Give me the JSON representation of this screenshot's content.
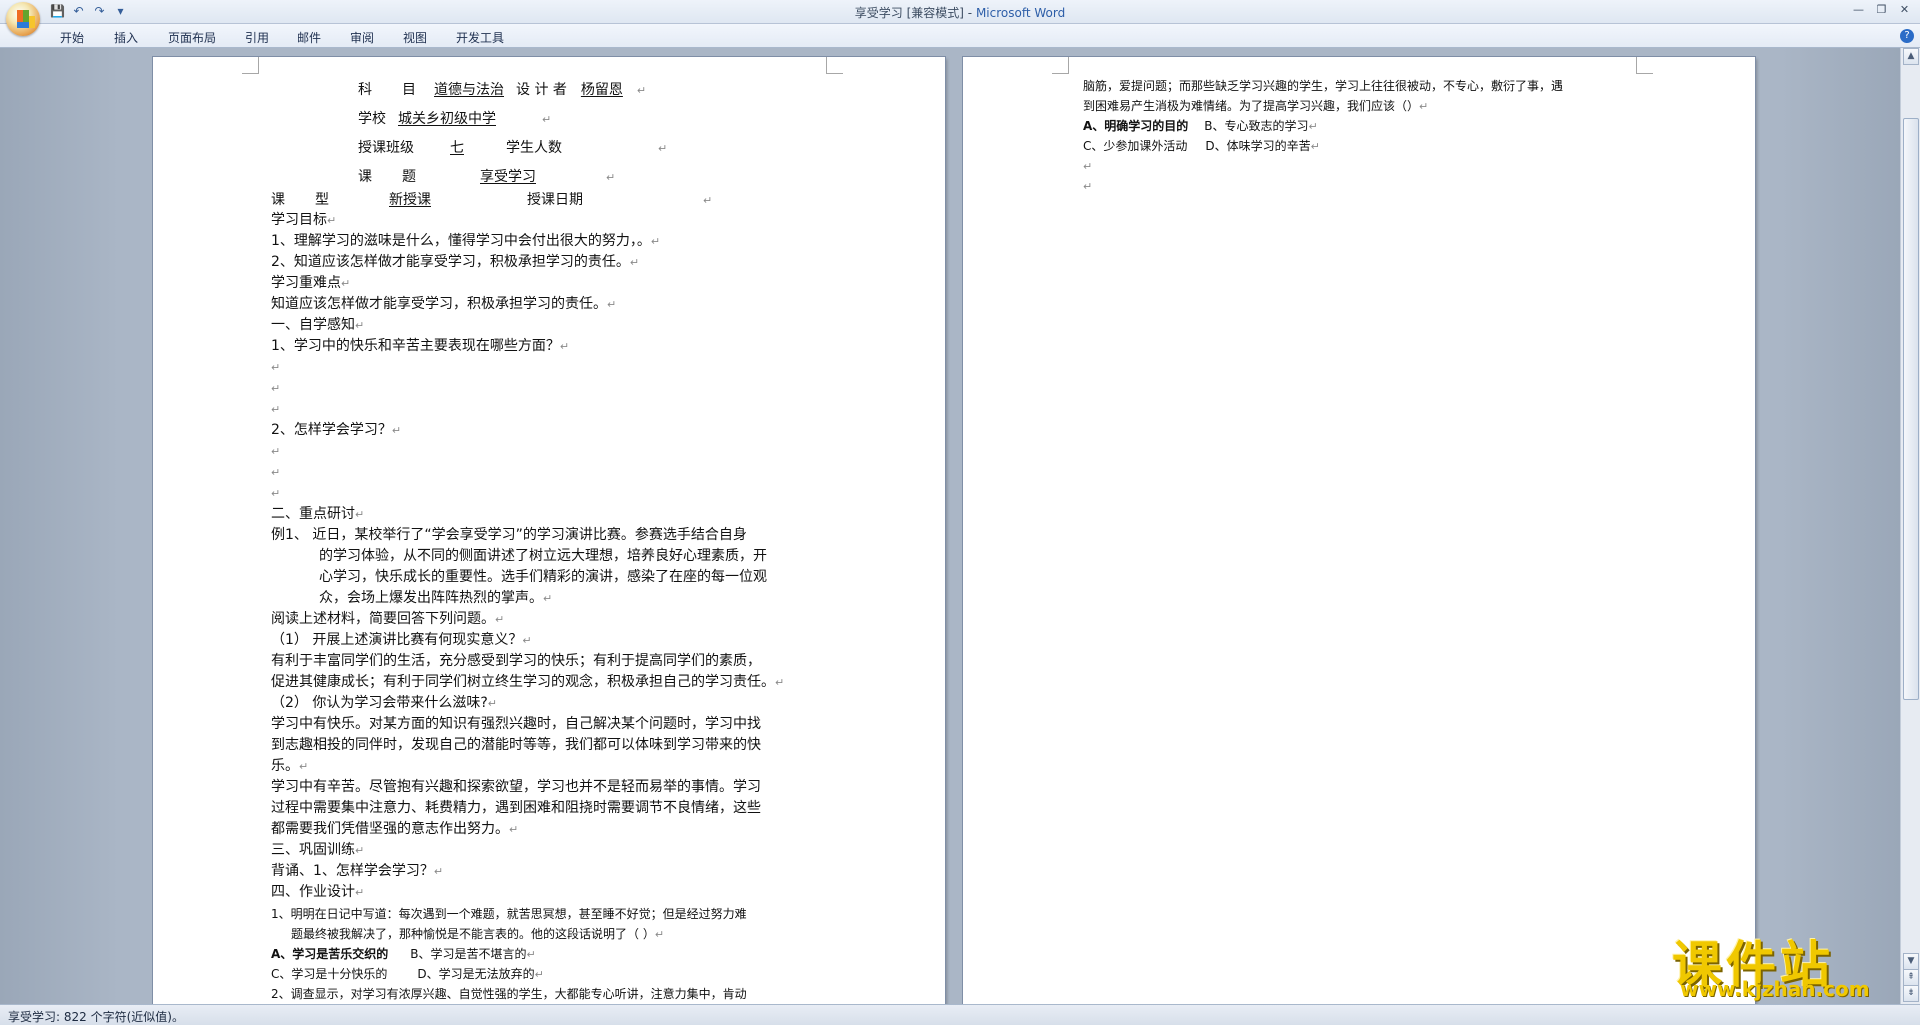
{
  "window": {
    "doc_title": "享受学习 [兼容模式]",
    "separator": " - ",
    "app_name": "Microsoft Word"
  },
  "ribbon": {
    "tabs": [
      "开始",
      "插入",
      "页面布局",
      "引用",
      "邮件",
      "审阅",
      "视图",
      "开发工具"
    ]
  },
  "icons": {
    "office_button": "office-button-icon",
    "save": "save-icon",
    "undo": "undo-icon",
    "redo": "redo-icon",
    "customize": "qat-dropdown-icon",
    "minimize": "minimize-icon",
    "restore": "restore-icon",
    "close": "close-icon",
    "help": "help-icon"
  },
  "left_page": {
    "subject_label": "科",
    "subject_label2": "目",
    "subject_value": "道德与法治",
    "designer_label": "设 计 者",
    "designer_value": "杨留恩",
    "school_label": "学校",
    "school_value": "城关乡初级中学",
    "class_label": "授课班级",
    "class_value": "七",
    "students_label": "学生人数",
    "topic_label": "课",
    "topic_label2": "题",
    "topic_value": "享受学习",
    "type_label": "课",
    "type_label2": "型",
    "type_value": "新授课",
    "date_label": "授课日期",
    "lines": [
      "学习目标",
      "1、理解学习的滋味是什么，懂得学习中会付出很大的努力，。",
      "2、知道应该怎样做才能享受学习，积极承担学习的责任。",
      "学习重难点",
      "知道应该怎样做才能享受学习，积极承担学习的责任。",
      "一、自学感知",
      "1、学习中的快乐和辛苦主要表现在哪些方面？",
      "",
      "",
      "",
      "2、怎样学会学习？",
      "",
      "",
      "",
      "二、重点研讨",
      "例1、   近日，某校举行了“学会享受学习”的学习演讲比赛。参赛选手结合自身",
      "的学习体验，从不同的侧面讲述了树立远大理想，培养良好心理素质，开",
      "心学习，快乐成长的重要性。选手们精彩的演讲，感染了在座的每一位观",
      "众，会场上爆发出阵阵热烈的掌声。",
      "阅读上述材料，简要回答下列问题。",
      "（1）  开展上述演讲比赛有何现实意义？",
      "有利于丰富同学们的生活，充分感受到学习的快乐；有利于提高同学们的素质，",
      "促进其健康成长；有利于同学们树立终生学习的观念，积极承担自己的学习责任。",
      "（2）  你认为学习会带来什么滋味?",
      "学习中有快乐。对某方面的知识有强烈兴趣时，自己解决某个问题时，学习中找",
      "到志趣相投的同伴时，发现自己的潜能时等等，我们都可以体味到学习带来的快",
      "乐。",
      "学习中有辛苦。尽管抱有兴趣和探索欲望，学习也并不是轻而易举的事情。学习",
      "过程中需要集中注意力、耗费精力，遇到困难和阻挠时需要调节不良情绪，这些",
      "都需要我们凭借坚强的意志作出努力。",
      "三、巩固训练",
      "背诵、1、怎样学会学习？",
      "四、作业设计",
      "1、明明在日记中写道：每次遇到一个难题，就苦思冥想，甚至睡不好觉；但是经过努力难",
      "题最终被我解决了，那种愉悦是不能言表的。他的这段话说明了（  ）",
      "A、学习是苦乐交织的",
      "B、学习是苦不堪言的",
      "C、学习是十分快乐的",
      "D、学习是无法放弃的",
      "2、调查显示，对学习有浓厚兴趣、自觉性强的学生，大都能专心听讲，注意力集中，肯动"
    ]
  },
  "right_page": {
    "lines": [
      "脑筋，爱提问题；而那些缺乏学习兴趣的学生，学习上往往很被动，不专心，敷衍了事，遇",
      "到困难易产生消极为难情绪。为了提高学习兴趣，我们应该（）",
      "A、明确学习的目的",
      "B、专心致志的学习",
      "C、少参加课外活动",
      "D、体味学习的辛苦"
    ]
  },
  "status": {
    "text": "享受学习: 822 个字符(近似值)。"
  },
  "watermark": {
    "main": "课件站",
    "sub": "www.kjzhan.com"
  },
  "marks": {
    "para": "↵"
  }
}
